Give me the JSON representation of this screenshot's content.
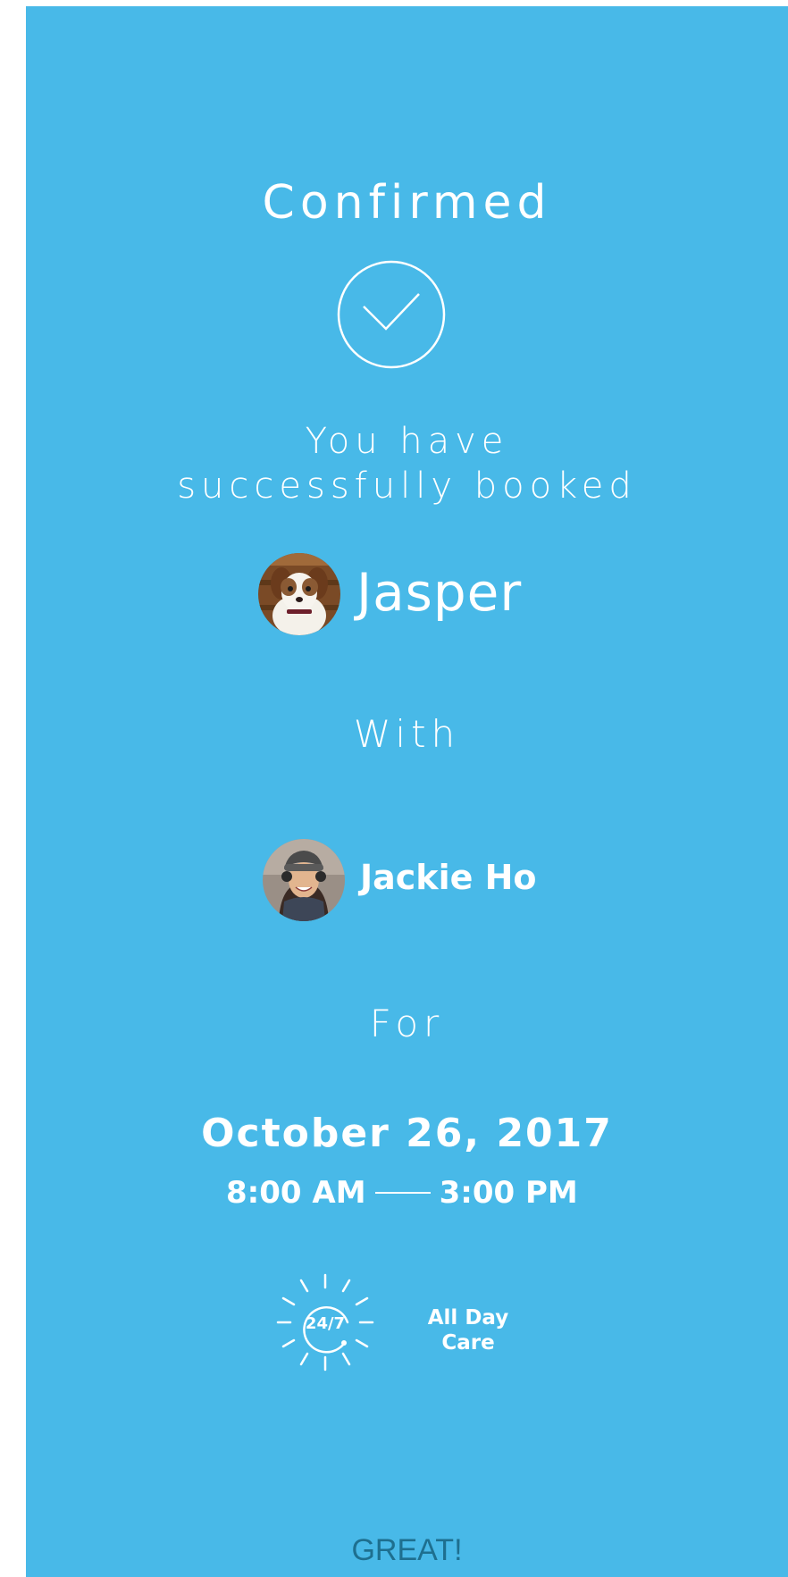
{
  "confirmation": {
    "title": "Confirmed",
    "subtitle_line1": "You have",
    "subtitle_line2": "successfully booked"
  },
  "pet": {
    "name": "Jasper"
  },
  "with_label": "With",
  "sitter": {
    "name": "Jackie Ho"
  },
  "for_label": "For",
  "booking": {
    "date": "October 26, 2017",
    "start_time": "8:00 AM",
    "end_time": "3:00 PM"
  },
  "service": {
    "icon_text": "24/7",
    "label_line1": "All Day",
    "label_line2": "Care"
  },
  "actions": {
    "great_label": "GREAT!"
  },
  "colors": {
    "background": "#48b9e8",
    "text": "#ffffff",
    "button_text": "#1e6f8f"
  },
  "icons": {
    "check": "check-circle-icon",
    "service": "sun-24-7-icon"
  }
}
